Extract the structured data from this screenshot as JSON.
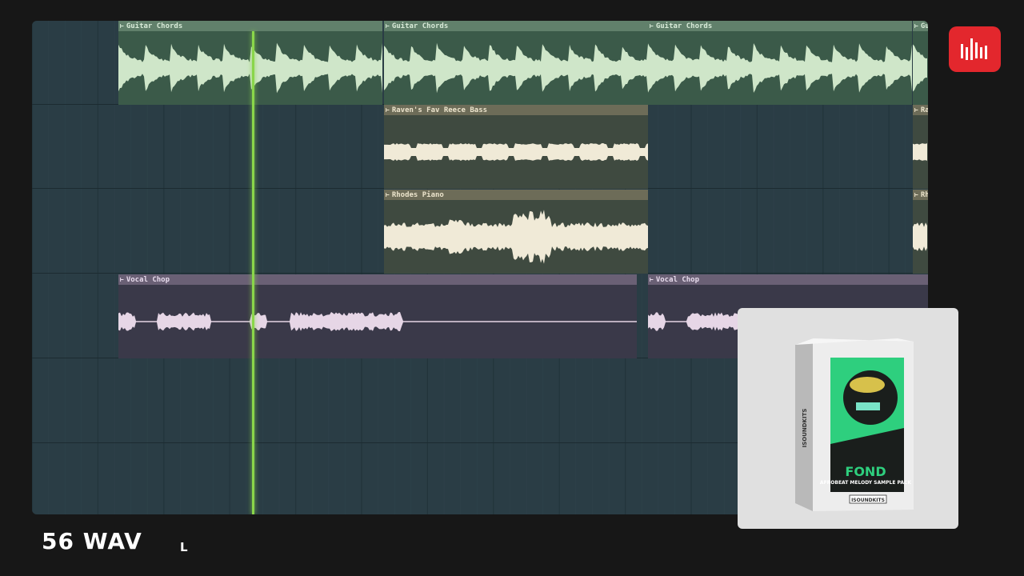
{
  "playlist": {
    "tracks": [
      {
        "name": "track-1",
        "clips": [
          {
            "label": "Guitar Chords",
            "color": "green"
          },
          {
            "label": "Guitar Chords",
            "color": "green"
          },
          {
            "label": "Guitar Chords",
            "color": "green"
          },
          {
            "label": "Gu",
            "color": "green"
          }
        ]
      },
      {
        "name": "track-2",
        "clips": [
          {
            "label": "Raven's Fav Reece Bass",
            "color": "tan"
          },
          {
            "label": "Ra",
            "color": "tan"
          }
        ]
      },
      {
        "name": "track-3",
        "clips": [
          {
            "label": "Rhodes Piano",
            "color": "tan"
          },
          {
            "label": "Rh",
            "color": "tan"
          }
        ]
      },
      {
        "name": "track-4",
        "clips": [
          {
            "label": "Vocal Chop",
            "color": "purple"
          },
          {
            "label": "Vocal Chop",
            "color": "purple"
          }
        ]
      }
    ],
    "clip_arrow": "⊢",
    "colors": {
      "background": "#2a3d45",
      "playhead": "#8ad64a",
      "guitar_wave": "#cfe6c9",
      "bass_wave": "#f0ead7",
      "vocal_wave": "#e6d6e6"
    }
  },
  "logo": {
    "icon": "sound-bars-icon",
    "color": "#e3272d"
  },
  "product": {
    "brand": "ISOUNDKITS",
    "title": "FOND",
    "subtitle": "AFROBEAT MELODY SAMPLE PACK"
  },
  "footer": {
    "count_label": "56 WAV",
    "suffix": "L"
  }
}
